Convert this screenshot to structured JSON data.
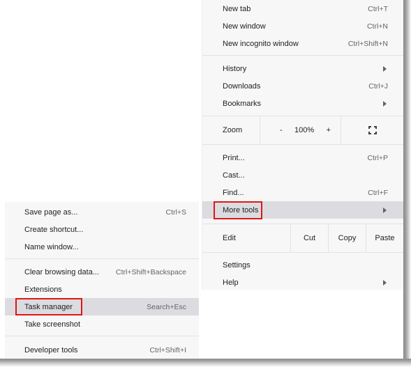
{
  "main_menu": {
    "items": [
      {
        "label": "New tab",
        "shortcut": "Ctrl+T"
      },
      {
        "label": "New window",
        "shortcut": "Ctrl+N"
      },
      {
        "label": "New incognito window",
        "shortcut": "Ctrl+Shift+N"
      },
      {
        "label": "History",
        "shortcut": ""
      },
      {
        "label": "Downloads",
        "shortcut": "Ctrl+J"
      },
      {
        "label": "Bookmarks",
        "shortcut": ""
      },
      {
        "label": "Print...",
        "shortcut": "Ctrl+P"
      },
      {
        "label": "Cast...",
        "shortcut": ""
      },
      {
        "label": "Find...",
        "shortcut": "Ctrl+F"
      },
      {
        "label": "More tools",
        "shortcut": ""
      },
      {
        "label": "Settings",
        "shortcut": ""
      },
      {
        "label": "Help",
        "shortcut": ""
      }
    ],
    "zoom": {
      "label": "Zoom",
      "minus": "-",
      "value": "100%",
      "plus": "+",
      "fullscreen_icon": "fullscreen-icon"
    },
    "edit": {
      "label": "Edit",
      "cut": "Cut",
      "copy": "Copy",
      "paste": "Paste"
    },
    "highlighted_item": "More tools"
  },
  "more_tools_submenu": {
    "items": [
      {
        "label": "Save page as...",
        "shortcut": "Ctrl+S"
      },
      {
        "label": "Create shortcut...",
        "shortcut": ""
      },
      {
        "label": "Name window...",
        "shortcut": ""
      },
      {
        "label": "Clear browsing data...",
        "shortcut": "Ctrl+Shift+Backspace"
      },
      {
        "label": "Extensions",
        "shortcut": ""
      },
      {
        "label": "Task manager",
        "shortcut": "Search+Esc"
      },
      {
        "label": "Take screenshot",
        "shortcut": ""
      },
      {
        "label": "Developer tools",
        "shortcut": "Ctrl+Shift+I"
      }
    ],
    "highlighted_item": "Task manager"
  },
  "colors": {
    "annotation_box": "#e01616",
    "highlight": "#dcdce0",
    "menu_background": "#f7f7f7"
  }
}
